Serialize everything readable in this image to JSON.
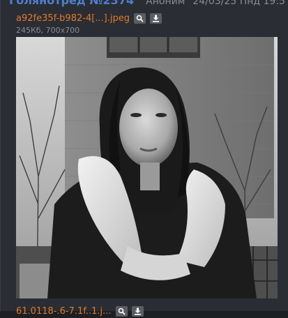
{
  "post": {
    "thread_title": "Голянотред №2374",
    "poster_name": "Аноним",
    "date": "24/03/25 Пнд 19:5"
  },
  "file": {
    "name": "a92fe35f-b982-4[...].jpeg",
    "meta": "245Кб, 700x700",
    "search_icon": "magnifier-icon",
    "download_icon": "download-icon"
  },
  "next_file": {
    "name": "61.0118-.6-7.1f..1.j..."
  },
  "colors": {
    "background": "#2a2d33",
    "title": "#4f7fcf",
    "file_link": "#e07a2d",
    "meta": "#8a8d93"
  }
}
